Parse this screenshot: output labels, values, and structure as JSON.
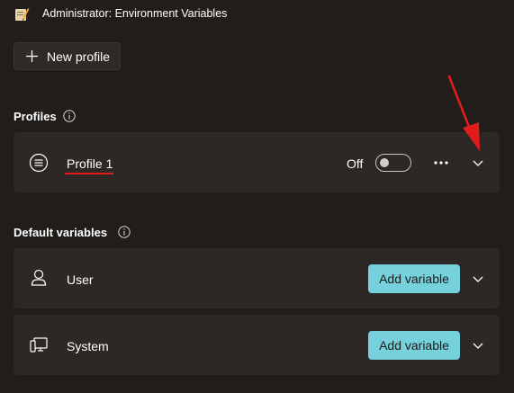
{
  "window": {
    "title": "Administrator: Environment Variables",
    "app_icon": "environment-variables-icon"
  },
  "toolbar": {
    "new_profile_label": "New profile",
    "new_profile_icon": "plus-icon"
  },
  "profiles_section": {
    "heading": "Profiles",
    "info_icon": "info-icon",
    "items": [
      {
        "name": "Profile 1",
        "icon": "list-icon",
        "toggle_label": "Off",
        "toggle_state": false,
        "more_icon": "more-dots-icon",
        "expand_icon": "chevron-down-icon"
      }
    ]
  },
  "default_variables_section": {
    "heading": "Default variables",
    "info_icon": "info-icon",
    "items": [
      {
        "name": "User",
        "icon": "user-icon",
        "button_label": "Add variable",
        "expand_icon": "chevron-down-icon"
      },
      {
        "name": "System",
        "icon": "system-icon",
        "button_label": "Add variable",
        "expand_icon": "chevron-down-icon"
      }
    ]
  },
  "colors": {
    "background": "#201d1a",
    "card": "#2b2825",
    "accent": "#76d1dc",
    "annotation": "#e21b1b"
  }
}
